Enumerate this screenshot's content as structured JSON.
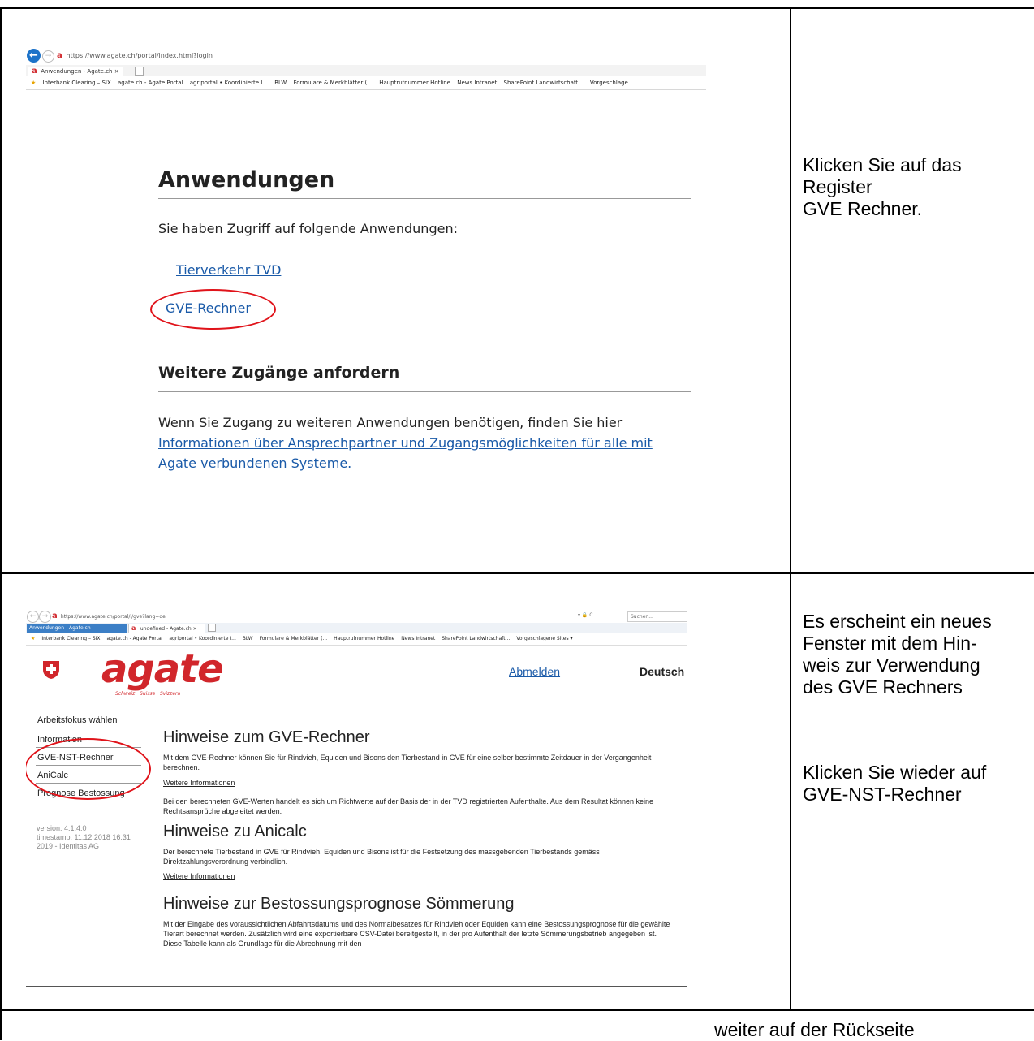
{
  "row1": {
    "instruction": "Klicken Sie auf das\nRegister\nGVE Rechner.",
    "screenshot": {
      "url": "https://www.agate.ch/portal/index.html?login",
      "tab_title": "Anwendungen - Agate.ch",
      "favorites": [
        "Interbank Clearing – SIX",
        "agate.ch - Agate Portal",
        "agriportal • Koordinierte I...",
        "BLW",
        "Formulare & Merkblätter (...",
        "Hauptrufnummer Hotline",
        "News Intranet",
        "SharePoint Landwirtschaft...",
        "Vorgeschlage"
      ],
      "title": "Anwendungen",
      "intro": "Sie haben Zugriff auf folgende Anwendungen:",
      "apps": [
        "Tierverkehr TVD",
        "GVE-Rechner"
      ],
      "section_title": "Weitere Zugänge anfordern",
      "paragraph_text": "Wenn Sie Zugang zu weiteren Anwendungen benötigen, finden Sie hier ",
      "paragraph_link": "Informationen über Ansprechpartner und Zugangsmöglichkeiten für alle mit Agate verbundenen Systeme."
    }
  },
  "row2": {
    "instruction": "Es erscheint ein neues\nFenster mit dem Hin-\nweis zur Verwendung\ndes GVE Rechners",
    "instruction2": "Klicken Sie wieder auf\nGVE-NST-Rechner",
    "screenshot": {
      "url": "https://www.agate.ch/portal/i/gve?lang=de",
      "search_placeholder": "Suchen...",
      "tabs": [
        "Anwendungen - Agate.ch",
        "undefined - Agate.ch"
      ],
      "favorites": [
        "Interbank Clearing – SIX",
        "agate.ch - Agate Portal",
        "agriportal • Koordinierte I...",
        "BLW",
        "Formulare & Merkblätter (...",
        "Hauptrufnummer Hotline",
        "News Intranet",
        "SharePoint Landwirtschaft...",
        "Vorgeschlagene Sites ▾"
      ],
      "logo_text": "agate",
      "logo_sub": "Schweiz · Suisse · Svizzera",
      "logout": "Abmelden",
      "language": "Deutsch",
      "side_heading": "Arbeitsfokus wählen",
      "nav": [
        "Information",
        "GVE-NST-Rechner",
        "AniCalc",
        "Prognose Bestossung"
      ],
      "version": "version: 4.1.4.0\ntimestamp: 11.12.2018 16:31\n2019 - Identitas AG",
      "h1": "Hinweise zum GVE-Rechner",
      "p1": "Mit dem GVE-Rechner können Sie für Rindvieh, Equiden und Bisons den Tierbestand in GVE für eine selber bestimmte Zeitdauer in der Vergangenheit berechnen.",
      "link1": "Weitere Informationen",
      "p2": "Bei den berechneten GVE-Werten handelt es sich um Richtwerte auf der Basis der in der TVD registrierten Aufenthalte. Aus dem Resultat können keine Rechtsansprüche abgeleitet werden.",
      "h2": "Hinweise zu Anicalc",
      "p3": "Der berechnete Tierbestand in GVE für Rindvieh, Equiden und Bisons ist für die Festsetzung des massgebenden Tierbestands gemäss Direktzahlungsverordnung verbindlich.",
      "link2": "Weitere Informationen",
      "h3": "Hinweise zur Bestossungsprognose Sömmerung",
      "p4": "Mit der Eingabe des voraussichtlichen Abfahrtsdatums und des Normalbesatzes für Rindvieh oder Equiden kann eine Bestossungsprognose für die gewählte Tierart berechnet werden. Zusätzlich wird eine exportierbare CSV-Datei bereitgestellt, in der pro Aufenthalt der letzte Sömmerungsbetrieb angegeben ist. Diese Tabelle kann als Grundlage für die Abrechnung mit den"
    }
  },
  "footer": "weiter auf der Rückseite"
}
